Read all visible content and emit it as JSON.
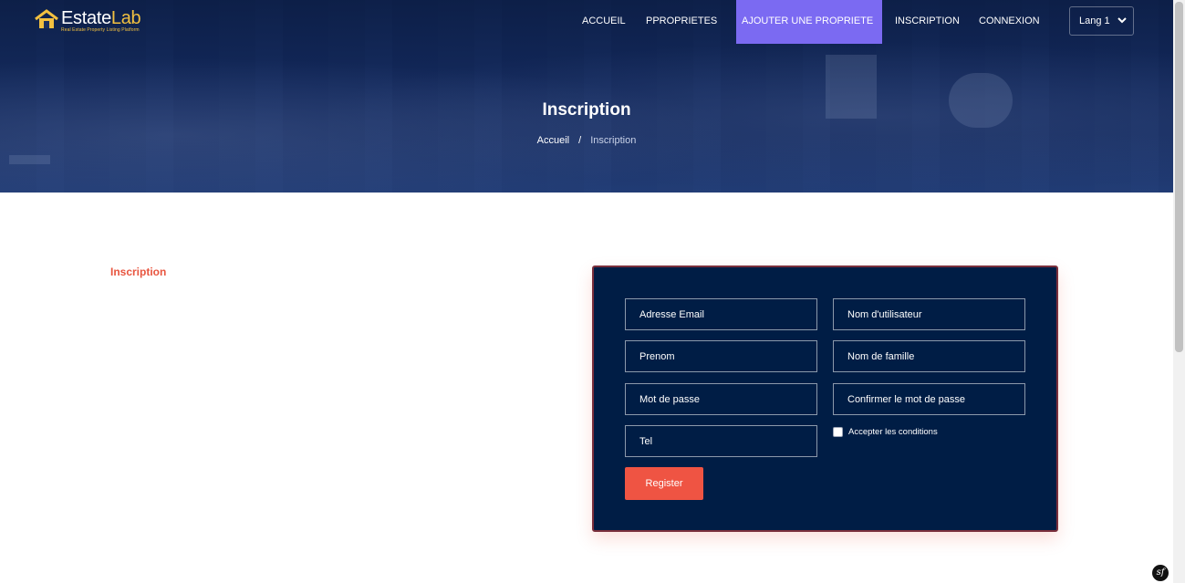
{
  "brand": {
    "name_part1": "Estate",
    "name_part2": "Lab",
    "tagline": "Real Estate Property Listing Platform"
  },
  "nav": {
    "items": [
      {
        "label": "ACCUEIL",
        "active": false
      },
      {
        "label": "PPROPRIETES",
        "active": false
      },
      {
        "label": "AJOUTER UNE PROPRIETE",
        "active": true
      },
      {
        "label": "INSCRIPTION",
        "active": false
      },
      {
        "label": "CONNEXION",
        "active": false
      }
    ],
    "language": "Lang 1"
  },
  "hero": {
    "title": "Inscription",
    "breadcrumb": {
      "home": "Accueil",
      "separator": "/",
      "current": "Inscription"
    }
  },
  "main": {
    "section_title": "Inscription"
  },
  "form": {
    "email_placeholder": "Adresse Email",
    "username_placeholder": "Nom d'utilisateur",
    "firstname_placeholder": "Prenom",
    "lastname_placeholder": "Nom de famille",
    "password_placeholder": "Mot de passe",
    "confirm_password_placeholder": "Confirmer le mot de passe",
    "phone_placeholder": "Tel",
    "terms_label": "Accepter les conditions",
    "terms_checked": false,
    "submit_label": "Register"
  },
  "colors": {
    "accent": "#ef5443",
    "active_nav": "#7b6af2",
    "card_bg": "#001d45",
    "brand_yellow": "#f2c040"
  }
}
